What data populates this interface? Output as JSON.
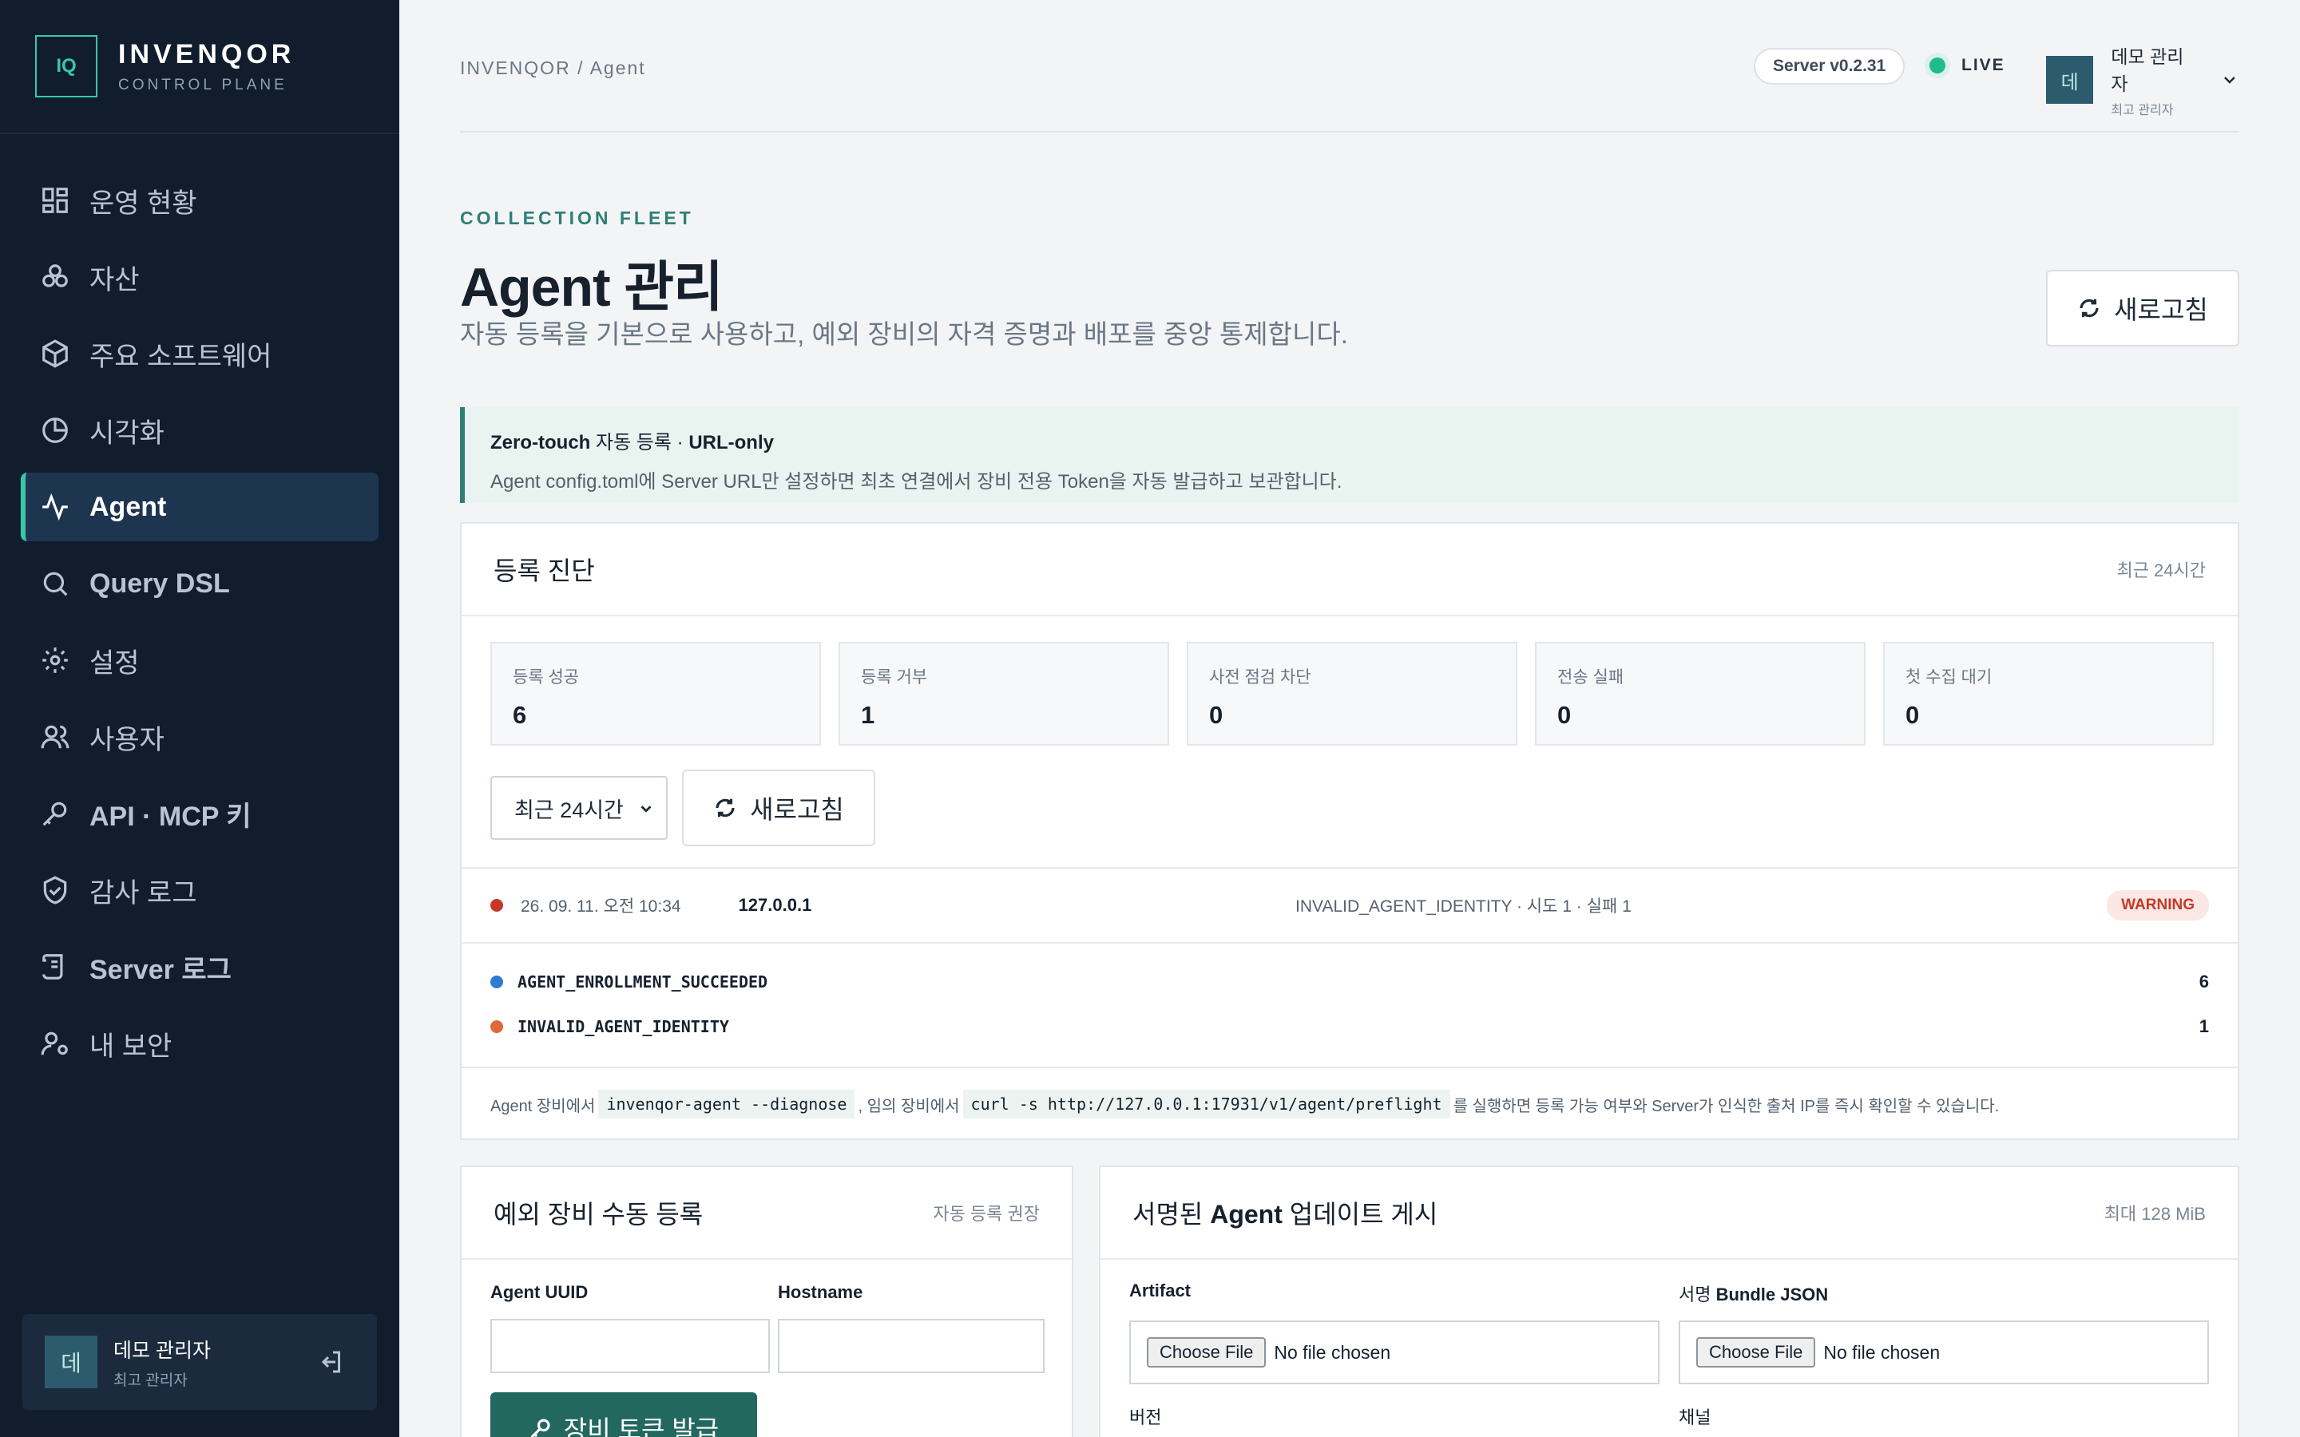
{
  "brand": {
    "logo": "IQ",
    "name": "INVENQOR",
    "subtitle": "CONTROL PLANE"
  },
  "sidebar": {
    "items": [
      {
        "label": "운영 현황",
        "icon": "dashboard-icon",
        "active": false
      },
      {
        "label": "자산",
        "icon": "assets-icon",
        "active": false
      },
      {
        "label": "주요 소프트웨어",
        "icon": "package-icon",
        "active": false
      },
      {
        "label": "시각화",
        "icon": "pie-chart-icon",
        "active": false
      },
      {
        "label": "Agent",
        "icon": "activity-icon",
        "active": true
      },
      {
        "label": "Query DSL",
        "icon": "search-icon",
        "active": false
      },
      {
        "label": "설정",
        "icon": "gear-icon",
        "active": false
      },
      {
        "label": "사용자",
        "icon": "users-icon",
        "active": false
      },
      {
        "label": "API · MCP 키",
        "icon": "key-icon",
        "active": false
      },
      {
        "label": "감사 로그",
        "icon": "shield-icon",
        "active": false
      },
      {
        "label": "Server 로그",
        "icon": "scroll-icon",
        "active": false
      },
      {
        "label": "내 보안",
        "icon": "user-gear-icon",
        "active": false
      }
    ],
    "user": {
      "avatar": "데",
      "name": "데모 관리자",
      "role": "최고 관리자"
    }
  },
  "header": {
    "breadcrumb": "INVENQOR / Agent",
    "server_version": "Server v0.2.31",
    "status": "LIVE",
    "user": {
      "avatar": "데",
      "name": "데모 관리자",
      "role": "최고 관리자"
    }
  },
  "page": {
    "eyebrow": "COLLECTION FLEET",
    "title": "Agent 관리",
    "subtitle": "자동 등록을 기본으로 사용하고, 예외 장비의 자격 증명과 배포를 중앙 통제합니다.",
    "refresh_label": "새로고침"
  },
  "notice": {
    "title_bold": "Zero-touch",
    "title_mid": " 자동 등록 · ",
    "title_bold2": "URL-only",
    "body": "Agent config.toml에 Server URL만 설정하면 최초 연결에서 장비 전용 Token을 자동 발급하고 보관합니다."
  },
  "diagnostics": {
    "title": "등록 진단",
    "period": "최근 24시간",
    "stats": [
      {
        "label": "등록 성공",
        "value": "6"
      },
      {
        "label": "등록 거부",
        "value": "1"
      },
      {
        "label": "사전 점검 차단",
        "value": "0"
      },
      {
        "label": "전송 실패",
        "value": "0"
      },
      {
        "label": "첫 수집 대기",
        "value": "0"
      }
    ],
    "range_select": "최근 24시간",
    "refresh_label": "새로고침",
    "event": {
      "time": "26. 09. 11. 오전 10:34",
      "ip": "127.0.0.1",
      "message": "INVALID_AGENT_IDENTITY · 시도 1 · 실패 1",
      "level": "WARNING",
      "dot_color": "#c4392a"
    },
    "counts": [
      {
        "code": "AGENT_ENROLLMENT_SUCCEEDED",
        "count": "6",
        "dot_color": "#2f7bd1"
      },
      {
        "code": "INVALID_AGENT_IDENTITY",
        "count": "1",
        "dot_color": "#e0683a"
      }
    ],
    "footnote": {
      "p1": "Agent 장비에서 ",
      "code1": "invenqor-agent --diagnose",
      "p2": ", 임의 장비에서 ",
      "code2": "curl -s http://127.0.0.1:17931/v1/agent/preflight",
      "p3": " 를 실행하면 등록 가능 여부와 Server가 인식한 출처 IP를 즉시 확인할 수 있습니다."
    }
  },
  "manual": {
    "title": "예외 장비 수동 등록",
    "meta": "자동 등록 권장",
    "uuid_label": "Agent UUID",
    "hostname_label": "Hostname",
    "issue_button": "장비 토큰 발급"
  },
  "update": {
    "title_pre": "서명된 ",
    "title_bold": "Agent",
    "title_post": " 업데이트 게시",
    "meta": "최대 128 MiB",
    "artifact_label": "Artifact",
    "bundle_label_pre": "서명 ",
    "bundle_label_bold": "Bundle JSON",
    "choose_file": "Choose File",
    "no_file": "No file chosen",
    "version_label": "버전",
    "channel_label": "채널"
  },
  "colors": {
    "accent": "#37c7a8",
    "sidebar_bg": "#111d2c",
    "primary_button": "#23685f",
    "warning": "#c4392a"
  }
}
